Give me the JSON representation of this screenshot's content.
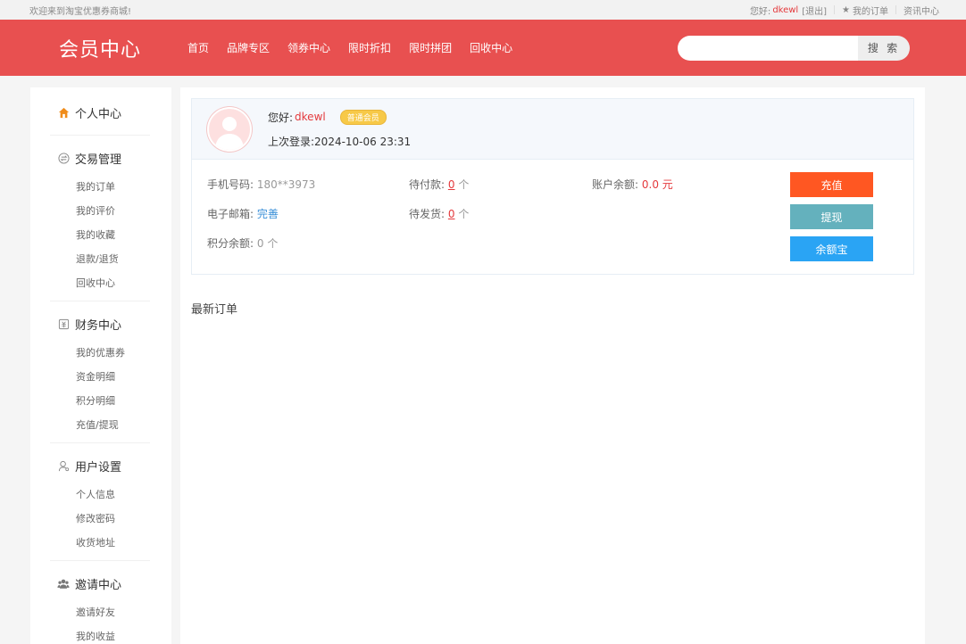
{
  "topbar": {
    "welcome": "欢迎来到淘宝优惠券商城!",
    "hello": "您好:",
    "username": "dkewl",
    "logout": "[退出]",
    "my_orders": "我的订单",
    "news": "资讯中心"
  },
  "header": {
    "logo": "会员中心",
    "nav": [
      "首页",
      "品牌专区",
      "领券中心",
      "限时折扣",
      "限时拼团",
      "回收中心"
    ],
    "search_placeholder": "",
    "search_button": "搜 索"
  },
  "sidebar": {
    "groups": [
      {
        "title": "个人中心",
        "icon": "home-icon",
        "items": []
      },
      {
        "title": "交易管理",
        "icon": "transaction-icon",
        "items": [
          "我的订单",
          "我的评价",
          "我的收藏",
          "退款/退货",
          "回收中心"
        ]
      },
      {
        "title": "财务中心",
        "icon": "finance-icon",
        "items": [
          "我的优惠券",
          "资金明细",
          "积分明细",
          "充值/提现"
        ]
      },
      {
        "title": "用户设置",
        "icon": "user-icon",
        "items": [
          "个人信息",
          "修改密码",
          "收货地址"
        ]
      },
      {
        "title": "邀请中心",
        "icon": "invite-icon",
        "items": [
          "邀请好友",
          "我的收益"
        ]
      }
    ]
  },
  "profile": {
    "hello": "您好:",
    "name": "dkewl",
    "level": "普通会员",
    "last_login_label": "上次登录:",
    "last_login": "2024-10-06 23:31"
  },
  "account": {
    "phone_label": "手机号码:",
    "phone": "180**3973",
    "email_label": "电子邮箱:",
    "email_action": "完善",
    "points_label": "积分余额:",
    "points": "0 个",
    "pending_pay_label": "待付款:",
    "pending_pay": "0",
    "pending_pay_unit": "个",
    "pending_ship_label": "待发货:",
    "pending_ship": "0",
    "pending_ship_unit": "个",
    "balance_label": "账户余额:",
    "balance": "0.0 元",
    "buttons": {
      "charge": "充值",
      "withdraw": "提现",
      "yeb": "余额宝"
    }
  },
  "recent_orders": "最新订单",
  "colors": {
    "brand": "#e85050",
    "accent_red": "#e4393c",
    "charge": "#ff5722",
    "withdraw": "#64b1bd",
    "yeb": "#2aa4f4"
  }
}
